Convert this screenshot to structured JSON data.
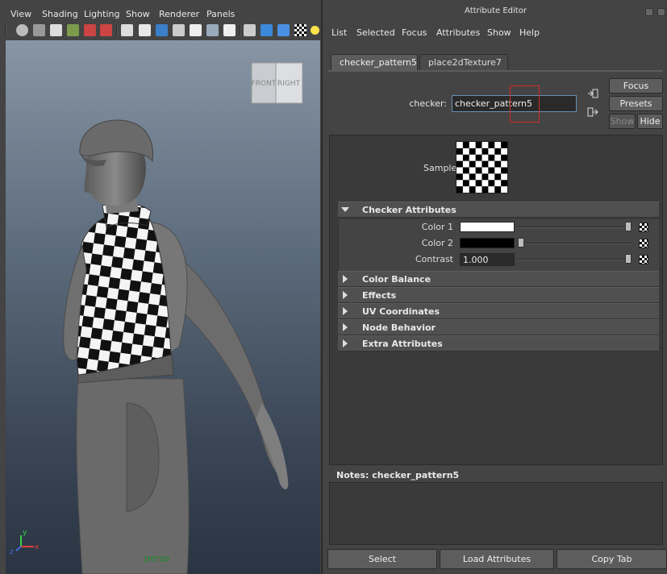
{
  "viewport": {
    "menu": [
      "View",
      "Shading",
      "Lighting",
      "Show",
      "Renderer",
      "Panels"
    ],
    "viewcube": {
      "front": "FRONT",
      "right": "RIGHT"
    },
    "camera_label": "persp",
    "axis": {
      "y": "y",
      "x": "x",
      "z": "z"
    }
  },
  "attribute_editor": {
    "title": "Attribute Editor",
    "menu": [
      "List",
      "Selected",
      "Focus",
      "Attributes",
      "Show",
      "Help"
    ],
    "tabs": [
      {
        "label": "checker_pattern5",
        "active": true
      },
      {
        "label": "place2dTexture7",
        "active": false
      }
    ],
    "node_label": "checker:",
    "node_name": "checker_pattern5",
    "buttons": {
      "focus": "Focus",
      "presets": "Presets",
      "show": "Show",
      "hide": "Hide"
    },
    "sample_label": "Sample",
    "sections": [
      {
        "label": "Checker Attributes",
        "expanded": true
      },
      {
        "label": "Color Balance",
        "expanded": false
      },
      {
        "label": "Effects",
        "expanded": false
      },
      {
        "label": "UV Coordinates",
        "expanded": false
      },
      {
        "label": "Node Behavior",
        "expanded": false
      },
      {
        "label": "Extra Attributes",
        "expanded": false
      }
    ],
    "checker_attributes": {
      "color1": {
        "label": "Color 1",
        "color": "#ffffff",
        "slider": 1.0
      },
      "color2": {
        "label": "Color 2",
        "color": "#000000",
        "slider": 0.0
      },
      "contrast": {
        "label": "Contrast",
        "value": "1.000",
        "slider": 1.0
      }
    },
    "notes_label": "Notes:",
    "notes_node": "checker_pattern5",
    "bottom_buttons": {
      "select": "Select",
      "load": "Load Attributes",
      "copy": "Copy Tab"
    }
  }
}
